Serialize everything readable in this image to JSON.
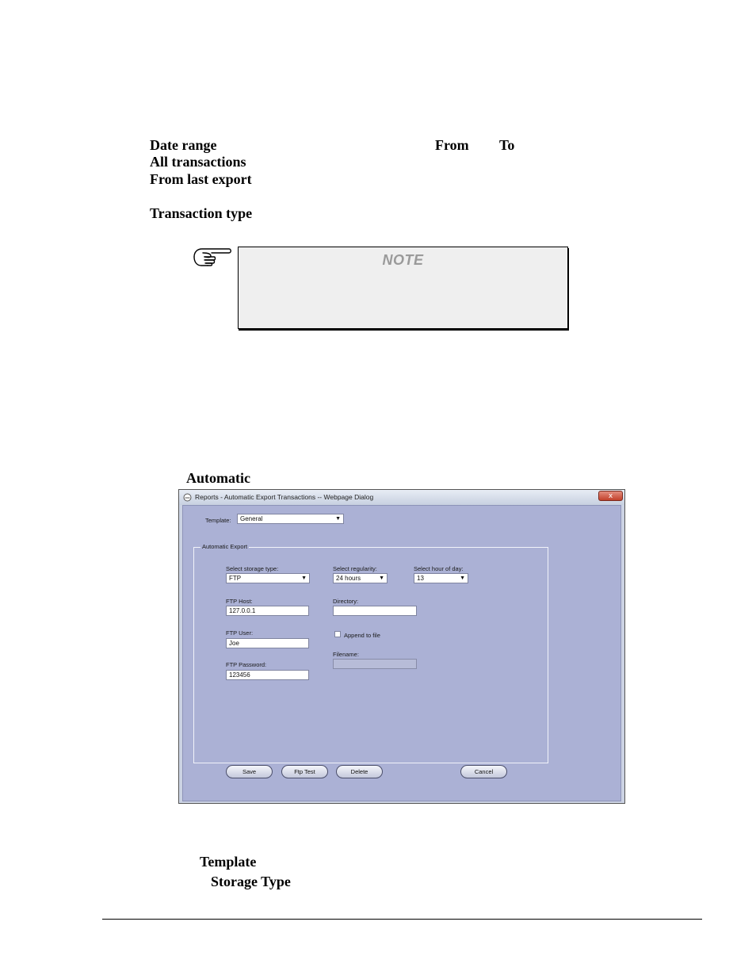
{
  "doc": {
    "date_range": "Date range",
    "from": "From",
    "to": "To",
    "all_transactions": "All transactions",
    "from_last_export": "From last export",
    "transaction_type": "Transaction type",
    "note_title": "NOTE",
    "automatic": "Automatic",
    "template": "Template",
    "storage_type": "Storage Type"
  },
  "icons": {
    "note": "pointing-hand-icon"
  },
  "dialog": {
    "title": "Reports - Automatic Export Transactions -- Webpage Dialog",
    "close": "x",
    "template_label": "Template:",
    "template_value": "General",
    "group_label": "Automatic Export",
    "storage_label": "Select storage type:",
    "storage_value": "FTP",
    "regularity_label": "Select regularity:",
    "regularity_value": "24 hours",
    "hour_label": "Select hour of day:",
    "hour_value": "13",
    "ftp_host_label": "FTP Host:",
    "ftp_host_value": "127.0.0.1",
    "directory_label": "Directory:",
    "directory_value": "",
    "ftp_user_label": "FTP User:",
    "ftp_user_value": "Joe",
    "append_label": "Append to file",
    "filename_label": "Filename:",
    "filename_value": "",
    "ftp_password_label": "FTP Password:",
    "ftp_password_value": "123456",
    "buttons": {
      "save": "Save",
      "ftp_test": "Ftp Test",
      "delete": "Delete",
      "cancel": "Cancel"
    }
  }
}
